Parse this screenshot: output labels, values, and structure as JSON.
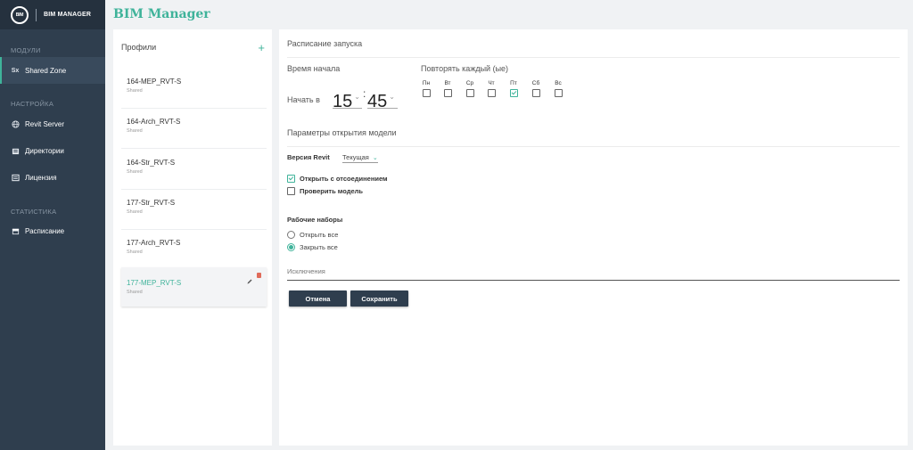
{
  "app": {
    "title": "BIM Manager",
    "logo_text": "BIM",
    "brand": "BIM MANAGER"
  },
  "sidebar": {
    "sections": [
      {
        "title": "МОДУЛИ",
        "items": [
          {
            "icon": "Sx",
            "label": "Shared Zone",
            "active": true
          }
        ]
      },
      {
        "title": "НАСТРОЙКА",
        "items": [
          {
            "icon": "globe-icon",
            "label": "Revit Server"
          },
          {
            "icon": "folder-icon",
            "label": "Директории"
          },
          {
            "icon": "license-icon",
            "label": "Лицензия"
          }
        ]
      },
      {
        "title": "СТАТИСТИКА",
        "items": [
          {
            "icon": "calendar-icon",
            "label": "Расписание"
          }
        ]
      }
    ]
  },
  "profiles": {
    "title": "Профили",
    "add_label": "+",
    "items": [
      {
        "name": "164-MEP_RVT-S",
        "sub": "Shared"
      },
      {
        "name": "164-Arch_RVT-S",
        "sub": "Shared"
      },
      {
        "name": "164-Str_RVT-S",
        "sub": "Shared"
      },
      {
        "name": "177-Str_RVT-S",
        "sub": "Shared"
      },
      {
        "name": "177-Arch_RVT-S",
        "sub": "Shared"
      },
      {
        "name": "177-MEP_RVT-S",
        "sub": "Shared",
        "selected": true
      }
    ]
  },
  "schedule": {
    "title": "Расписание запуска",
    "start_time_label": "Время начала",
    "start_at_label": "Начать в",
    "hour": "15",
    "minute": "45",
    "repeat_label": "Повторять каждый (ые)",
    "days": [
      {
        "label": "Пн",
        "checked": false
      },
      {
        "label": "Вт",
        "checked": false
      },
      {
        "label": "Ср",
        "checked": false
      },
      {
        "label": "Чт",
        "checked": false
      },
      {
        "label": "Пт",
        "checked": true
      },
      {
        "label": "Сб",
        "checked": false
      },
      {
        "label": "Вс",
        "checked": false
      }
    ]
  },
  "model_params": {
    "title": "Параметры открытия модели",
    "revit_version_label": "Версия Revit",
    "revit_version_value": "Текущая",
    "detach_label": "Открыть с отсоединением",
    "detach_checked": true,
    "audit_label": "Проверить модель",
    "audit_checked": false,
    "worksets_label": "Рабочие наборы",
    "open_all_label": "Открыть все",
    "close_all_label": "Закрыть все",
    "worksets_selected": "close_all",
    "exceptions_placeholder": "Исключения"
  },
  "buttons": {
    "cancel": "Отмена",
    "save": "Сохранить"
  },
  "colors": {
    "accent": "#3fb39a",
    "sidebar": "#2f3e4e",
    "danger": "#e06b5a"
  }
}
